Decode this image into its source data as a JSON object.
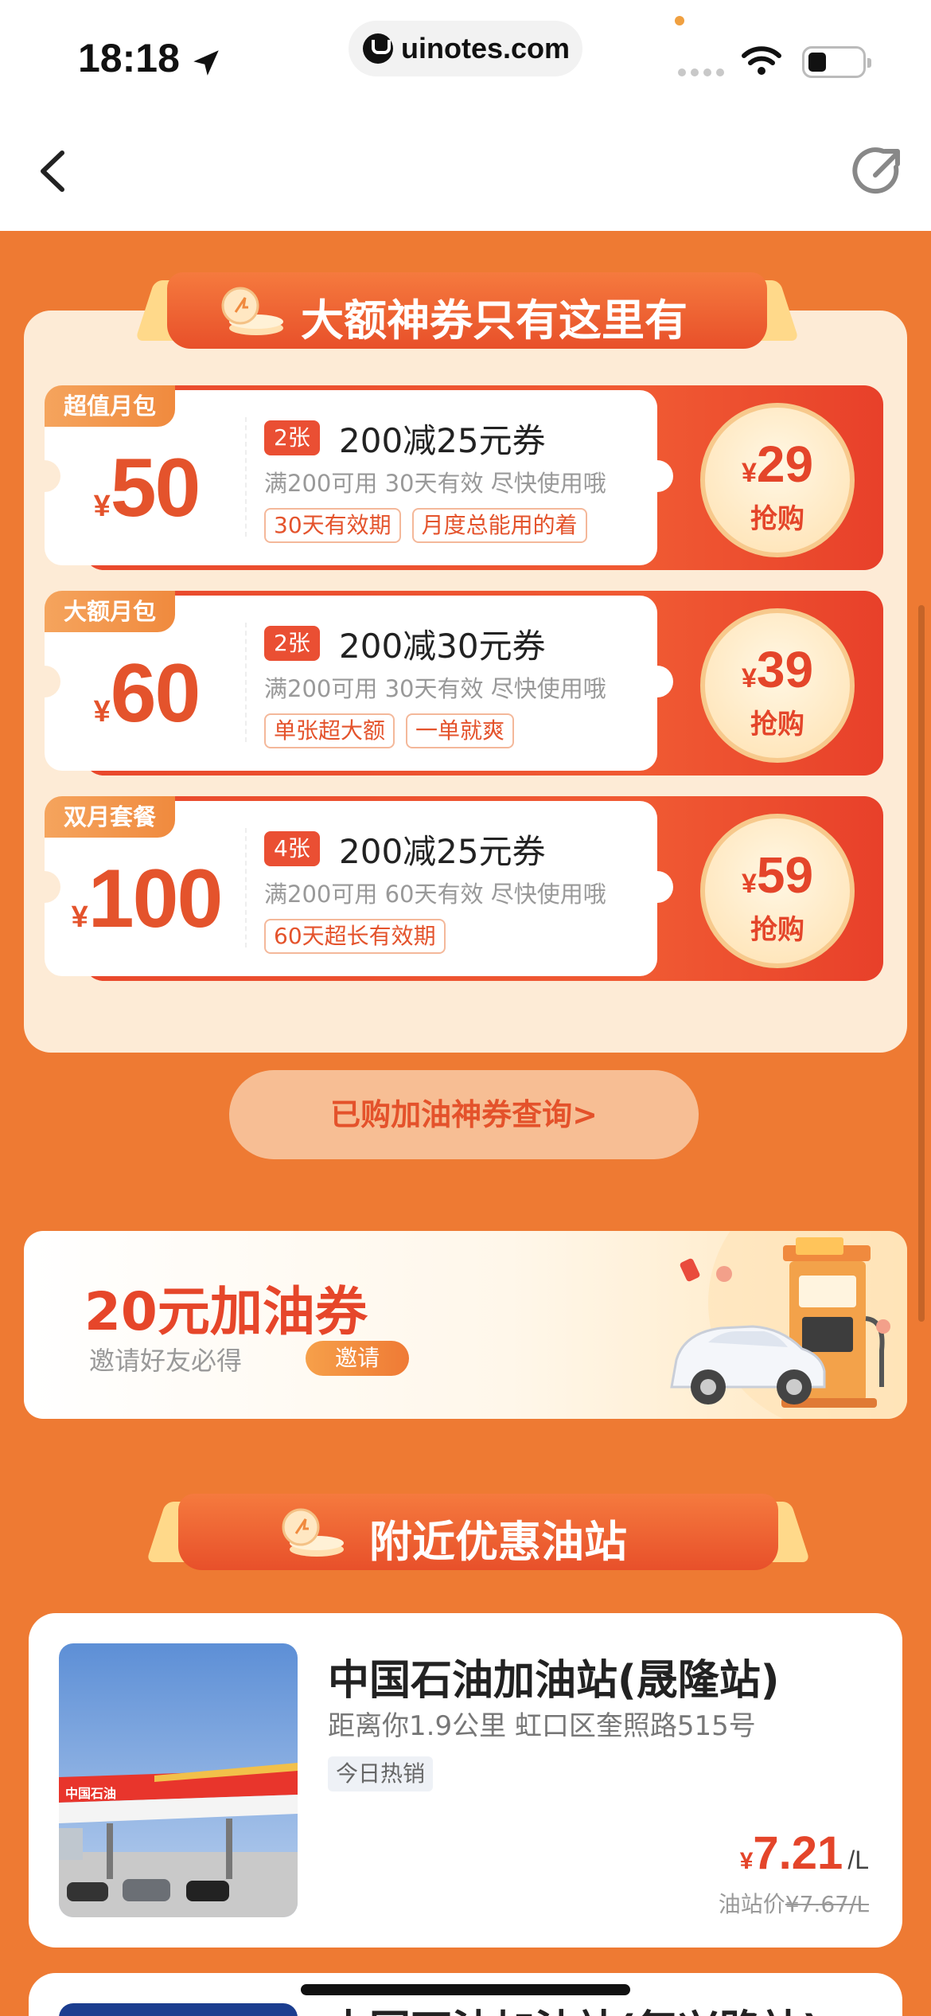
{
  "status_bar": {
    "time": "18:18",
    "url": "uinotes.com"
  },
  "coupon_section": {
    "title": "大额神券只有这里有",
    "coupons": [
      {
        "tag": "超值月包",
        "yen": "¥",
        "amount": "50",
        "count": "2张",
        "title": "200减25元券",
        "desc": "满200可用 30天有效 尽快使用哦",
        "chips": [
          "30天有效期",
          "月度总能用的着"
        ],
        "price": "29",
        "action": "抢购"
      },
      {
        "tag": "大额月包",
        "yen": "¥",
        "amount": "60",
        "count": "2张",
        "title": "200减30元券",
        "desc": "满200可用 30天有效 尽快使用哦",
        "chips": [
          "单张超大额",
          "一单就爽"
        ],
        "price": "39",
        "action": "抢购"
      },
      {
        "tag": "双月套餐",
        "yen": "¥",
        "amount": "100",
        "count": "4张",
        "title": "200减25元券",
        "desc": "满200可用 60天有效 尽快使用哦",
        "chips": [
          "60天超长有效期"
        ],
        "price": "59",
        "action": "抢购"
      }
    ],
    "query_button": "已购加油神券查询>"
  },
  "invite_banner": {
    "title": "20元加油券",
    "subtitle": "邀请好友必得",
    "button": "邀请"
  },
  "nearby_section": {
    "title": "附近优惠油站",
    "stations": [
      {
        "name": "中国石油加油站(晟隆站)",
        "distance": "距离你1.9公里",
        "address": "虹口区奎照路515号",
        "tag": "今日热销",
        "price_yen": "¥",
        "price": "7.21",
        "unit": "/L",
        "old_label": "油站价",
        "old_price": "¥7.67/L"
      },
      {
        "name": "中国石油加油站(复兴路站)"
      }
    ]
  },
  "colors": {
    "background": "#ee7a33",
    "accent": "#e4532c",
    "panel": "#fdebd6"
  }
}
